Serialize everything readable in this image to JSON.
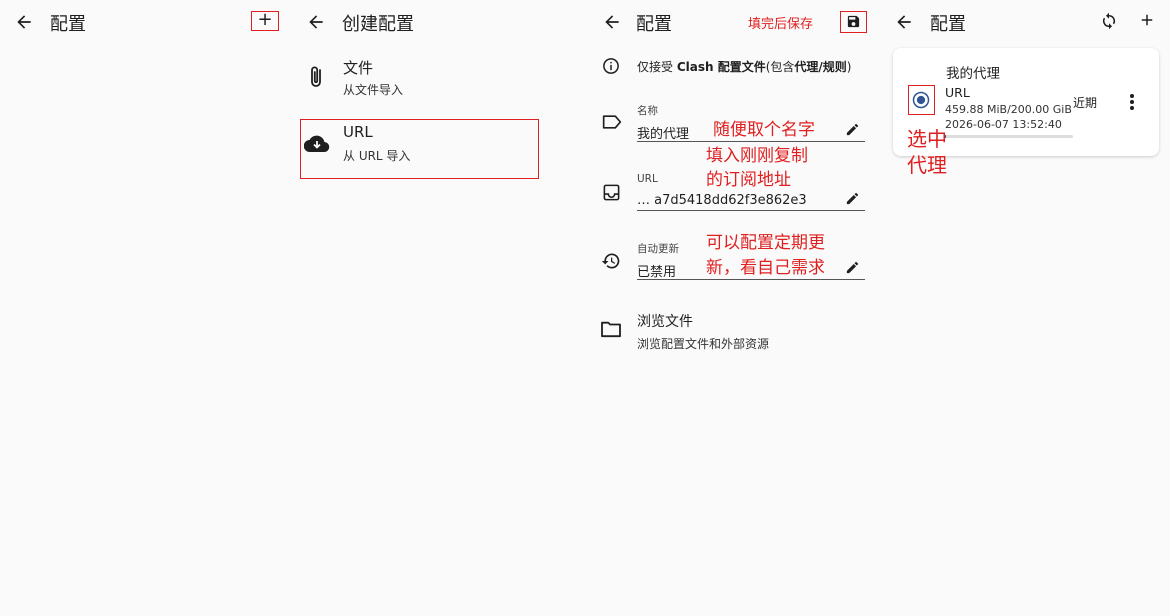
{
  "panel1": {
    "title": "配置",
    "add_glyph": "+"
  },
  "panel2": {
    "title": "创建配置",
    "items": [
      {
        "title": "文件",
        "subtitle": "从文件导入",
        "icon": "paperclip-icon"
      },
      {
        "title": "URL",
        "subtitle": "从 URL 导入",
        "icon": "cloud-download-icon"
      }
    ]
  },
  "panel3": {
    "title": "配置",
    "save_hint": "填完后保存",
    "info_prefix": "仅接受 ",
    "info_bold1": "Clash 配置文件",
    "info_mid": "(包含",
    "info_bold2": "代理/规则",
    "info_suffix": ")",
    "name_label": "名称",
    "name_value": "我的代理",
    "name_hint": "随便取个名字",
    "url_label": "URL",
    "url_value": "…     a7d5418dd62f3e862e3",
    "url_hint_line1": "填入刚刚复制",
    "url_hint_line2": "的订阅地址",
    "auto_label": "自动更新",
    "auto_value": "已禁用",
    "auto_hint_line1": "可以配置定期更",
    "auto_hint_line2": "新，看自己需求",
    "browse_title": "浏览文件",
    "browse_subtitle": "浏览配置文件和外部资源"
  },
  "panel4": {
    "title": "配置",
    "card": {
      "name": "我的代理",
      "type": "URL",
      "usage": "459.88 MiB/200.00 GiB",
      "updated": "2026-06-07 13:52:40",
      "recency": "近期",
      "usage_fraction": 0.0023
    },
    "select_hint_line1": "选中",
    "select_hint_line2": "代理"
  },
  "colors": {
    "annotation": "#e02020",
    "radio": "#2f5596",
    "background": "#fafafa"
  }
}
